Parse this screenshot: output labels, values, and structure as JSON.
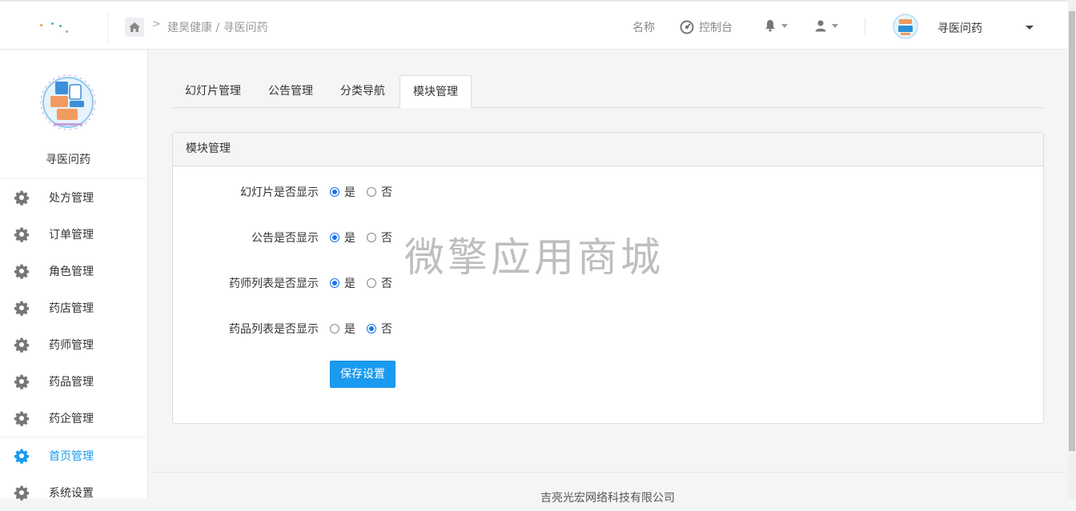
{
  "header": {
    "breadcrumb": {
      "parent": "建昊健康",
      "separator": "/",
      "current": "寻医问药"
    },
    "name_label": "名称",
    "console_label": "控制台",
    "user_name": "寻医问药"
  },
  "sidebar": {
    "title": "寻医问药",
    "items": [
      {
        "label": "处方管理",
        "active": false
      },
      {
        "label": "订单管理",
        "active": false
      },
      {
        "label": "角色管理",
        "active": false
      },
      {
        "label": "药店管理",
        "active": false
      },
      {
        "label": "药师管理",
        "active": false
      },
      {
        "label": "药品管理",
        "active": false
      },
      {
        "label": "药企管理",
        "active": false
      },
      {
        "label": "首页管理",
        "active": true
      },
      {
        "label": "系统设置",
        "active": false
      }
    ]
  },
  "tabs": [
    {
      "label": "幻灯片管理",
      "active": false
    },
    {
      "label": "公告管理",
      "active": false
    },
    {
      "label": "分类导航",
      "active": false
    },
    {
      "label": "模块管理",
      "active": true
    }
  ],
  "panel": {
    "title": "模块管理",
    "rows": [
      {
        "label": "幻灯片是否显示",
        "yes": "是",
        "no": "否",
        "selected": "yes"
      },
      {
        "label": "公告是否显示",
        "yes": "是",
        "no": "否",
        "selected": "yes"
      },
      {
        "label": "药师列表是否显示",
        "yes": "是",
        "no": "否",
        "selected": "yes"
      },
      {
        "label": "药品列表是否显示",
        "yes": "是",
        "no": "否",
        "selected": "no"
      }
    ],
    "save_label": "保存设置"
  },
  "watermark": "微擎应用商城",
  "footer": "吉亮光宏网络科技有限公司",
  "colors": {
    "accent": "#1a9bf0",
    "radio_checked": "#1a73e8",
    "page_bg": "#f4f5f7"
  }
}
